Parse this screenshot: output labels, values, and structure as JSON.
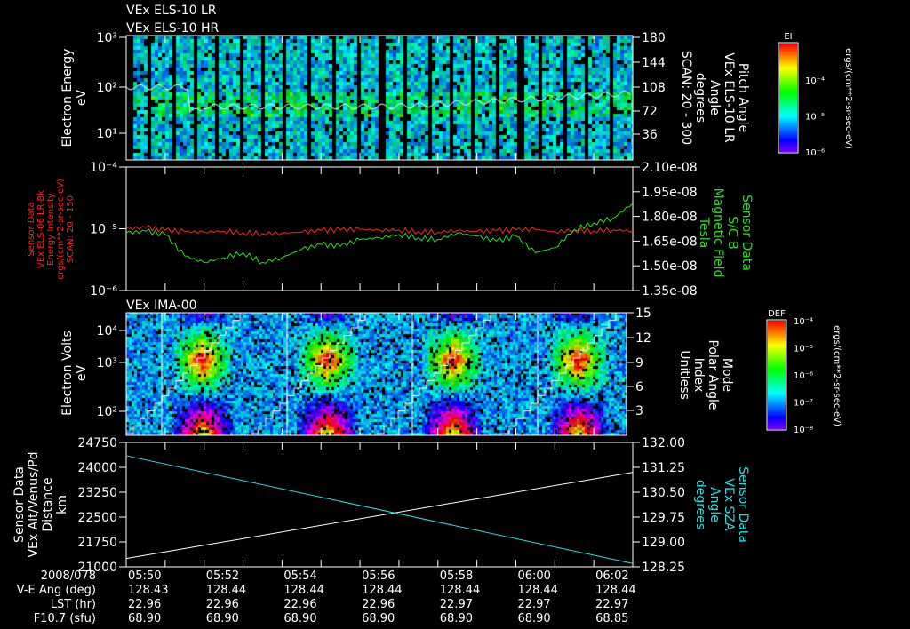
{
  "titles": {
    "p1_a": "VEx ELS-10 LR",
    "p1_b": "VEx ELS-10 HR",
    "p3": "VEx IMA-00"
  },
  "colors": {
    "white": "#ffffff",
    "red": "#ff2020",
    "green": "#20e020",
    "cyan": "#20e0e0"
  },
  "panel1": {
    "ylabel": [
      "Electron Energy",
      "eV"
    ],
    "yticks": [
      "10¹",
      "10²",
      "10³"
    ],
    "right_label": [
      "Pitch Angle",
      "VEx ELS-10 LR",
      "Angle",
      "degrees",
      "SCAN: 20 - 300"
    ],
    "right_ticks": [
      "36",
      "72",
      "108",
      "144",
      "180"
    ],
    "colorbar": {
      "title": "EI",
      "ticks": [
        "10⁻⁴",
        "10⁻⁵",
        "10⁻⁶"
      ],
      "units": "ergs/(cm**2-sr-sec-eV)"
    }
  },
  "panel3": {
    "ylabel": [
      "Electron Volts",
      "eV"
    ],
    "yticks": [
      "10²",
      "10³",
      "10⁴"
    ],
    "right_label": [
      "Mode",
      "Polar Angle",
      "Index",
      "Unitless"
    ],
    "right_ticks": [
      "3",
      "6",
      "9",
      "12",
      "15"
    ],
    "colorbar": {
      "title": "DEF",
      "ticks": [
        "10⁻⁴",
        "10⁻⁵",
        "10⁻⁶",
        "10⁻⁷",
        "10⁻⁸"
      ],
      "units": "ergs/(cm**2-sr-sec-eV)"
    }
  },
  "chart_data": [
    {
      "type": "line",
      "title": "Panel 2",
      "x_minutes_after_0550": [
        0,
        0.5,
        1,
        1.5,
        2,
        2.5,
        3,
        3.5,
        4,
        4.5,
        5,
        5.5,
        6,
        6.5,
        7,
        7.5,
        8,
        8.5,
        9,
        9.5,
        10,
        10.5,
        11,
        11.5,
        12,
        12.5,
        13
      ],
      "series": [
        {
          "name": "Energy Intensity",
          "axis": "left",
          "color": "red",
          "values": [
            1e-05,
            1.05e-05,
            9.5e-06,
            9e-06,
            8.8e-06,
            9.2e-06,
            8.6e-06,
            8.4e-06,
            8.5e-06,
            8.8e-06,
            9.4e-06,
            9.6e-06,
            9.8e-06,
            9.5e-06,
            9.6e-06,
            9e-06,
            8.8e-06,
            9.4e-06,
            9e-06,
            9.3e-06,
            9.6e-06,
            9.8e-06,
            8.9e-06,
            9.5e-06,
            9.3e-06,
            9.6e-06,
            9.2e-06
          ]
        },
        {
          "name": "S/C B Magnetic Field",
          "axis": "right",
          "color": "green",
          "values": [
            1.7e-08,
            1.71e-08,
            1.69e-08,
            1.56e-08,
            1.52e-08,
            1.55e-08,
            1.58e-08,
            1.52e-08,
            1.55e-08,
            1.6e-08,
            1.63e-08,
            1.62e-08,
            1.66e-08,
            1.67e-08,
            1.69e-08,
            1.67e-08,
            1.66e-08,
            1.7e-08,
            1.68e-08,
            1.65e-08,
            1.68e-08,
            1.58e-08,
            1.61e-08,
            1.72e-08,
            1.76e-08,
            1.79e-08,
            1.88e-08
          ]
        }
      ],
      "left_label": [
        "Sensor Data",
        "VEx ELS-06 LR-Bk",
        "Energy Intensity",
        "ergs/(cm**2-sr-sec-eV)",
        "SCAN: 20 - 150"
      ],
      "left_ticks": [
        "10⁻⁴",
        "10⁻⁵",
        "10⁻⁶"
      ],
      "ylim_left": [
        1e-06,
        0.0001
      ],
      "right_label": [
        "Sensor Data",
        "S/C B",
        "Magnetic Field",
        "Tesla"
      ],
      "right_ticks": [
        "2.10e-08",
        "1.95e-08",
        "1.80e-08",
        "1.65e-08",
        "1.50e-08",
        "1.35e-08"
      ],
      "ylim_right": [
        1.35e-08,
        2.1e-08
      ]
    },
    {
      "type": "line",
      "title": "Panel 4",
      "x_minutes_after_0550": [
        0,
        13
      ],
      "series": [
        {
          "name": "VEx Alt/Venus/Pd Distance",
          "axis": "left",
          "color": "white",
          "values": [
            21250,
            23850
          ]
        },
        {
          "name": "VEx SZA Angle",
          "axis": "right",
          "color": "cyan",
          "values": [
            131.6,
            128.35
          ]
        }
      ],
      "left_label": [
        "Sensor Data",
        "VEx Alt/Venus/Pd",
        "Distance",
        "km"
      ],
      "left_ticks": [
        "24750",
        "24000",
        "23250",
        "22500",
        "21750",
        "21000"
      ],
      "ylim_left": [
        21000,
        24750
      ],
      "right_label": [
        "Sensor Data",
        "VEx SZA",
        "Angle",
        "degrees"
      ],
      "right_ticks": [
        "132.00",
        "131.25",
        "130.50",
        "129.75",
        "129.00",
        "128.25"
      ],
      "ylim_right": [
        128.25,
        132.0
      ]
    }
  ],
  "xaxis": {
    "row_labels": [
      "2008/078",
      "V-E Ang (deg)",
      "LST (hr)",
      "F10.7 (sfu)"
    ],
    "times": [
      "05:50",
      "05:52",
      "05:54",
      "05:56",
      "05:58",
      "06:00",
      "06:02"
    ],
    "ve_ang": [
      "128.43",
      "128.44",
      "128.44",
      "128.44",
      "128.44",
      "128.44",
      "128.44"
    ],
    "lst": [
      "22.96",
      "22.96",
      "22.96",
      "22.96",
      "22.97",
      "22.97",
      "22.97"
    ],
    "f107": [
      "68.90",
      "68.90",
      "68.90",
      "68.90",
      "68.90",
      "68.90",
      "68.85"
    ]
  }
}
